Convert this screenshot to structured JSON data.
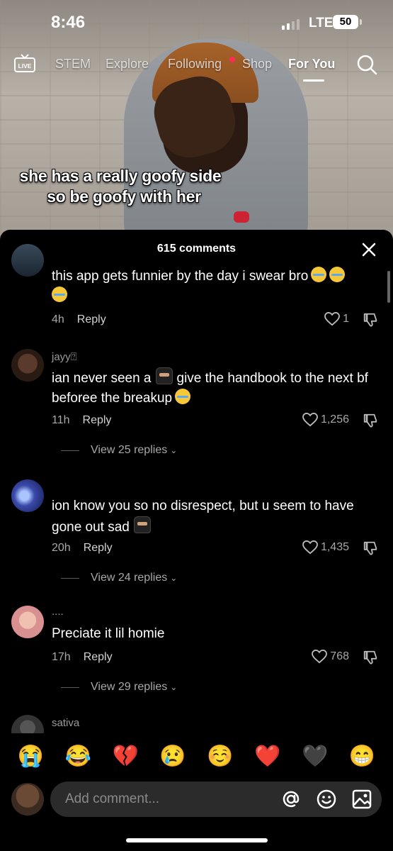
{
  "status_bar": {
    "time": "8:46",
    "network": "LTE",
    "battery": "50"
  },
  "nav": {
    "items": [
      "STEM",
      "Explore",
      "Following",
      "Shop",
      "For You"
    ],
    "live_label": "LIVE",
    "active": "For You"
  },
  "video": {
    "caption_line1": "she has a really goofy side",
    "caption_line2": "so be goofy with her"
  },
  "comments_header": "615 comments",
  "comments": [
    {
      "username": "",
      "text": "this app gets funnier by the day i swear bro",
      "time": "4h",
      "reply": "Reply",
      "likes": "1"
    },
    {
      "username": "jayy⍰",
      "text_before": "ian never seen a",
      "text_after": "give the handbook to the next bf beforee the breakup",
      "time": "11h",
      "reply": "Reply",
      "likes": "1,256",
      "view_replies": "View 25 replies"
    },
    {
      "username": "",
      "text": "ion know you so no disrespect, but u seem to have gone out sad",
      "time": "20h",
      "reply": "Reply",
      "likes": "1,435",
      "view_replies": "View 24 replies"
    },
    {
      "username": "....",
      "text": "Preciate it lil homie",
      "time": "17h",
      "reply": "Reply",
      "likes": "768",
      "view_replies": "View 29 replies"
    },
    {
      "username": "sativa"
    }
  ],
  "emoji_bar": [
    "😭",
    "😂",
    "💔",
    "😢",
    "☺️",
    "❤️",
    "🖤",
    "😁"
  ],
  "input": {
    "placeholder": "Add comment..."
  },
  "colors": {
    "accent": "#fe2c55",
    "sheet_bg": "#000000",
    "input_bg": "#2b2b2b"
  }
}
